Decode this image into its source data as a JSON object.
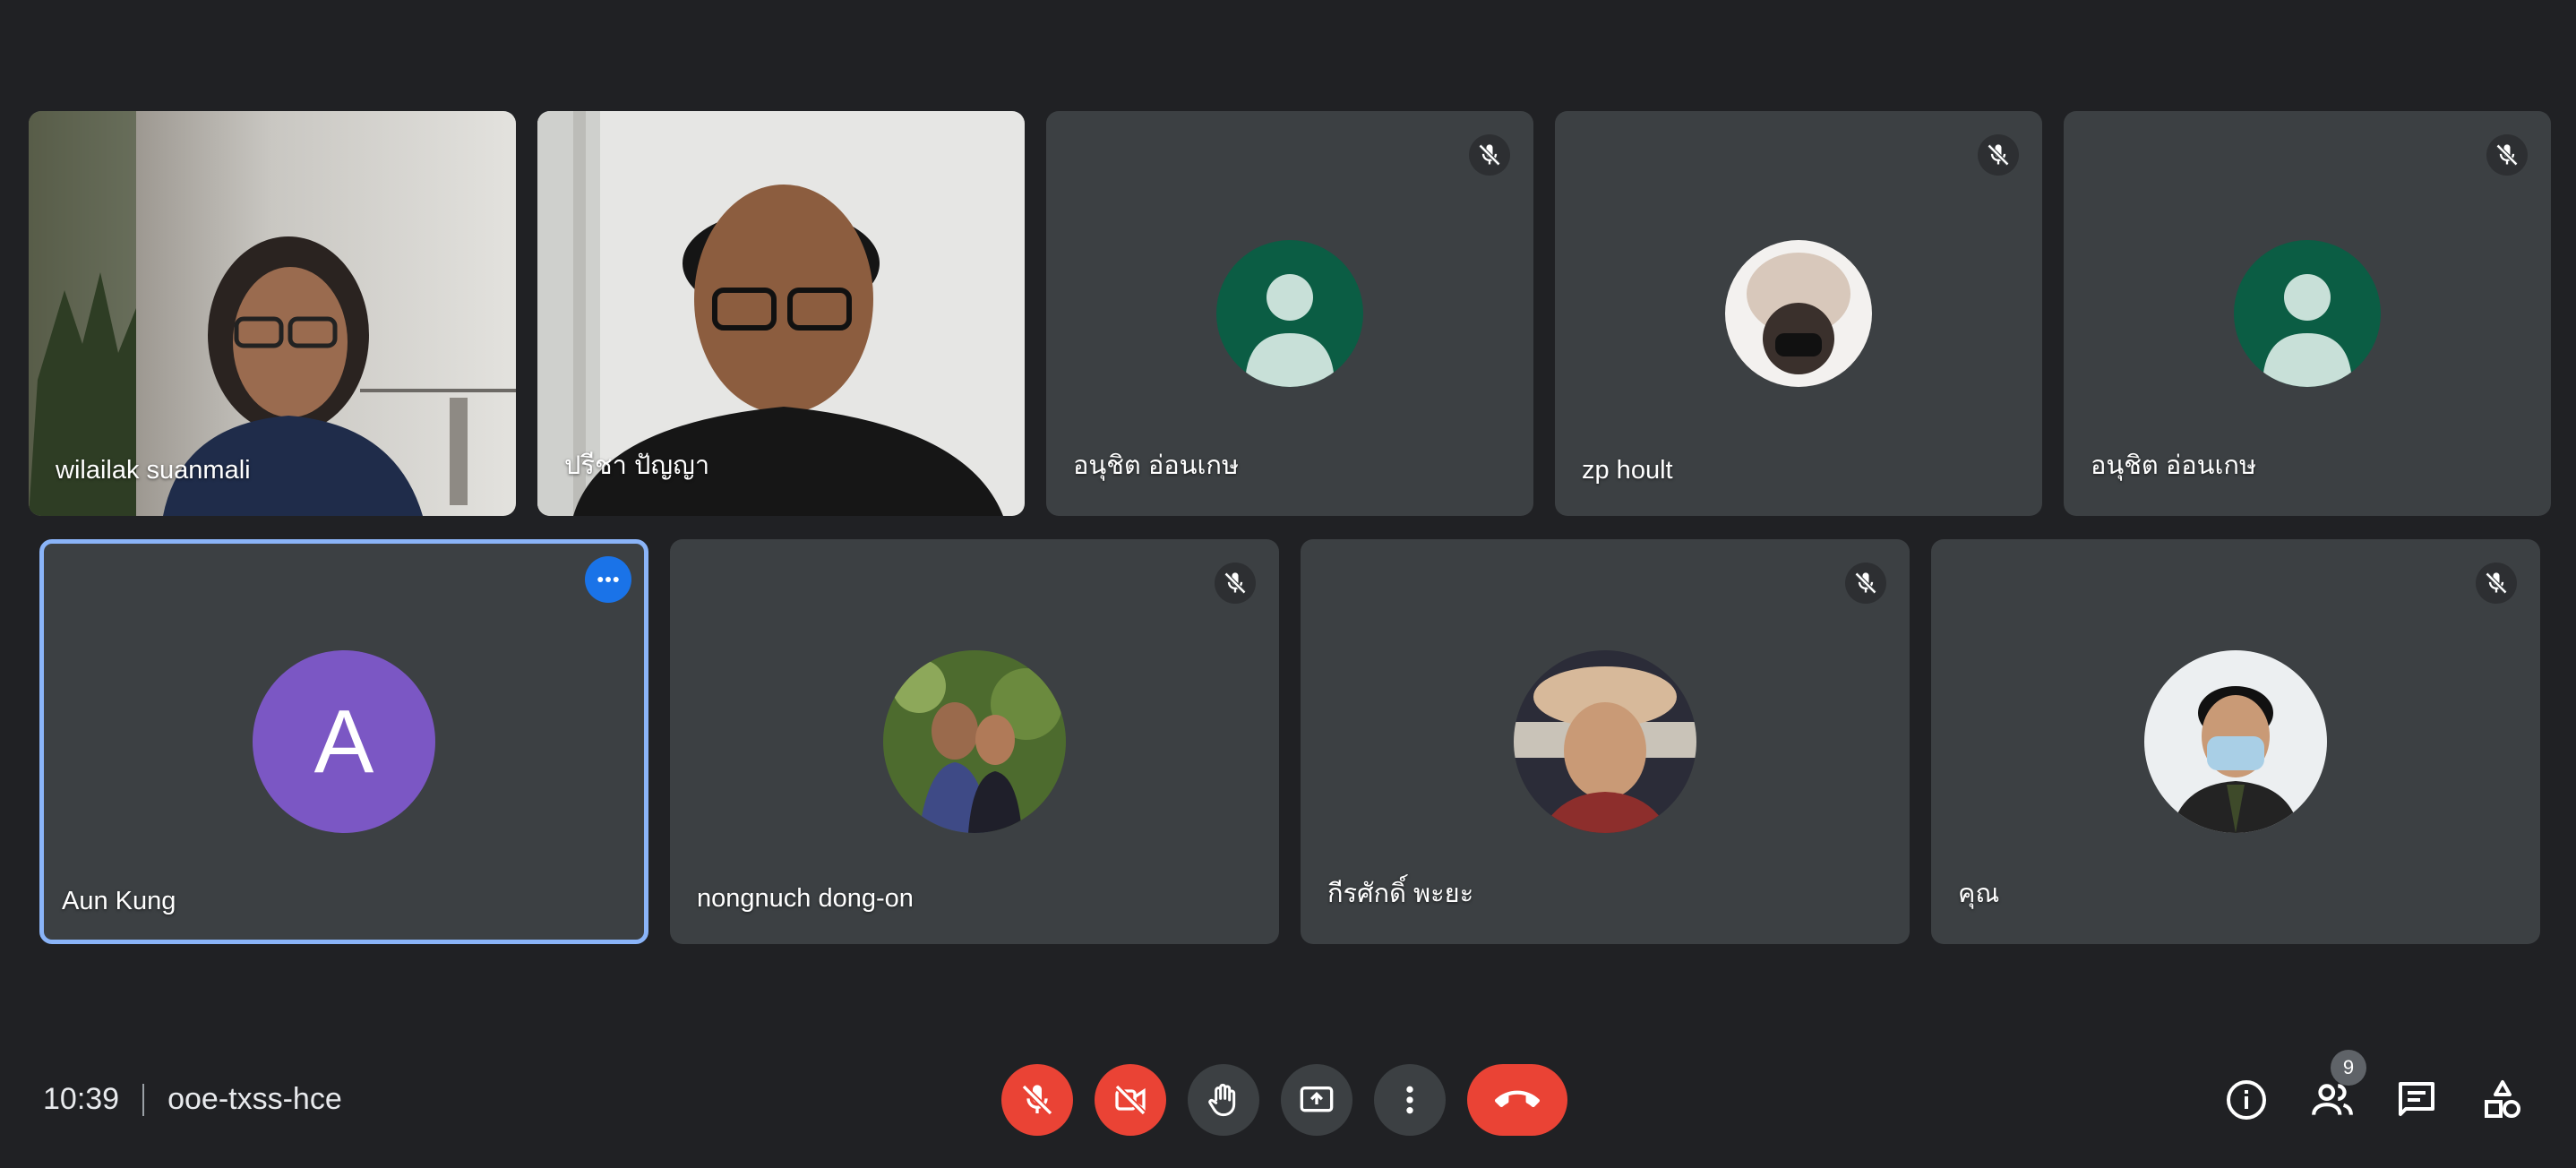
{
  "participants": [
    {
      "name": "wilailak suanmali",
      "muted": false,
      "video": true
    },
    {
      "name": "ปรีชา ปัญญา",
      "muted": false,
      "video": true
    },
    {
      "name": "อนุชิต อ่อนเกษ",
      "muted": true,
      "video": false
    },
    {
      "name": "zp hoult",
      "muted": true,
      "video": false
    },
    {
      "name": "อนุชิต อ่อนเกษ",
      "muted": true,
      "video": false
    },
    {
      "name": "Aun Kung",
      "muted": false,
      "video": false,
      "avatar_letter": "A",
      "active": true
    },
    {
      "name": "nongnuch dong-on",
      "muted": true,
      "video": false
    },
    {
      "name": "กีรศักดิ์ พะยะ",
      "muted": true,
      "video": false
    },
    {
      "name": "คุณ",
      "muted": true,
      "video": false
    }
  ],
  "meeting": {
    "time": "10:39",
    "code": "ooe-txss-hce"
  },
  "participants_count": "9",
  "icons": {
    "mic_off": "mic-off-icon",
    "camera_off": "videocam-off-icon",
    "raise_hand": "hand-icon",
    "present": "present-screen-icon",
    "more": "more-vert-icon",
    "leave": "call-end-icon",
    "info": "info-icon",
    "people": "people-icon",
    "chat": "chat-icon",
    "activities": "activities-icon"
  },
  "colors": {
    "background": "#202124",
    "tile": "#3c4043",
    "danger": "#ea4335",
    "accent": "#8ab4f8",
    "avatar_letter_bg": "#7b57c4"
  }
}
